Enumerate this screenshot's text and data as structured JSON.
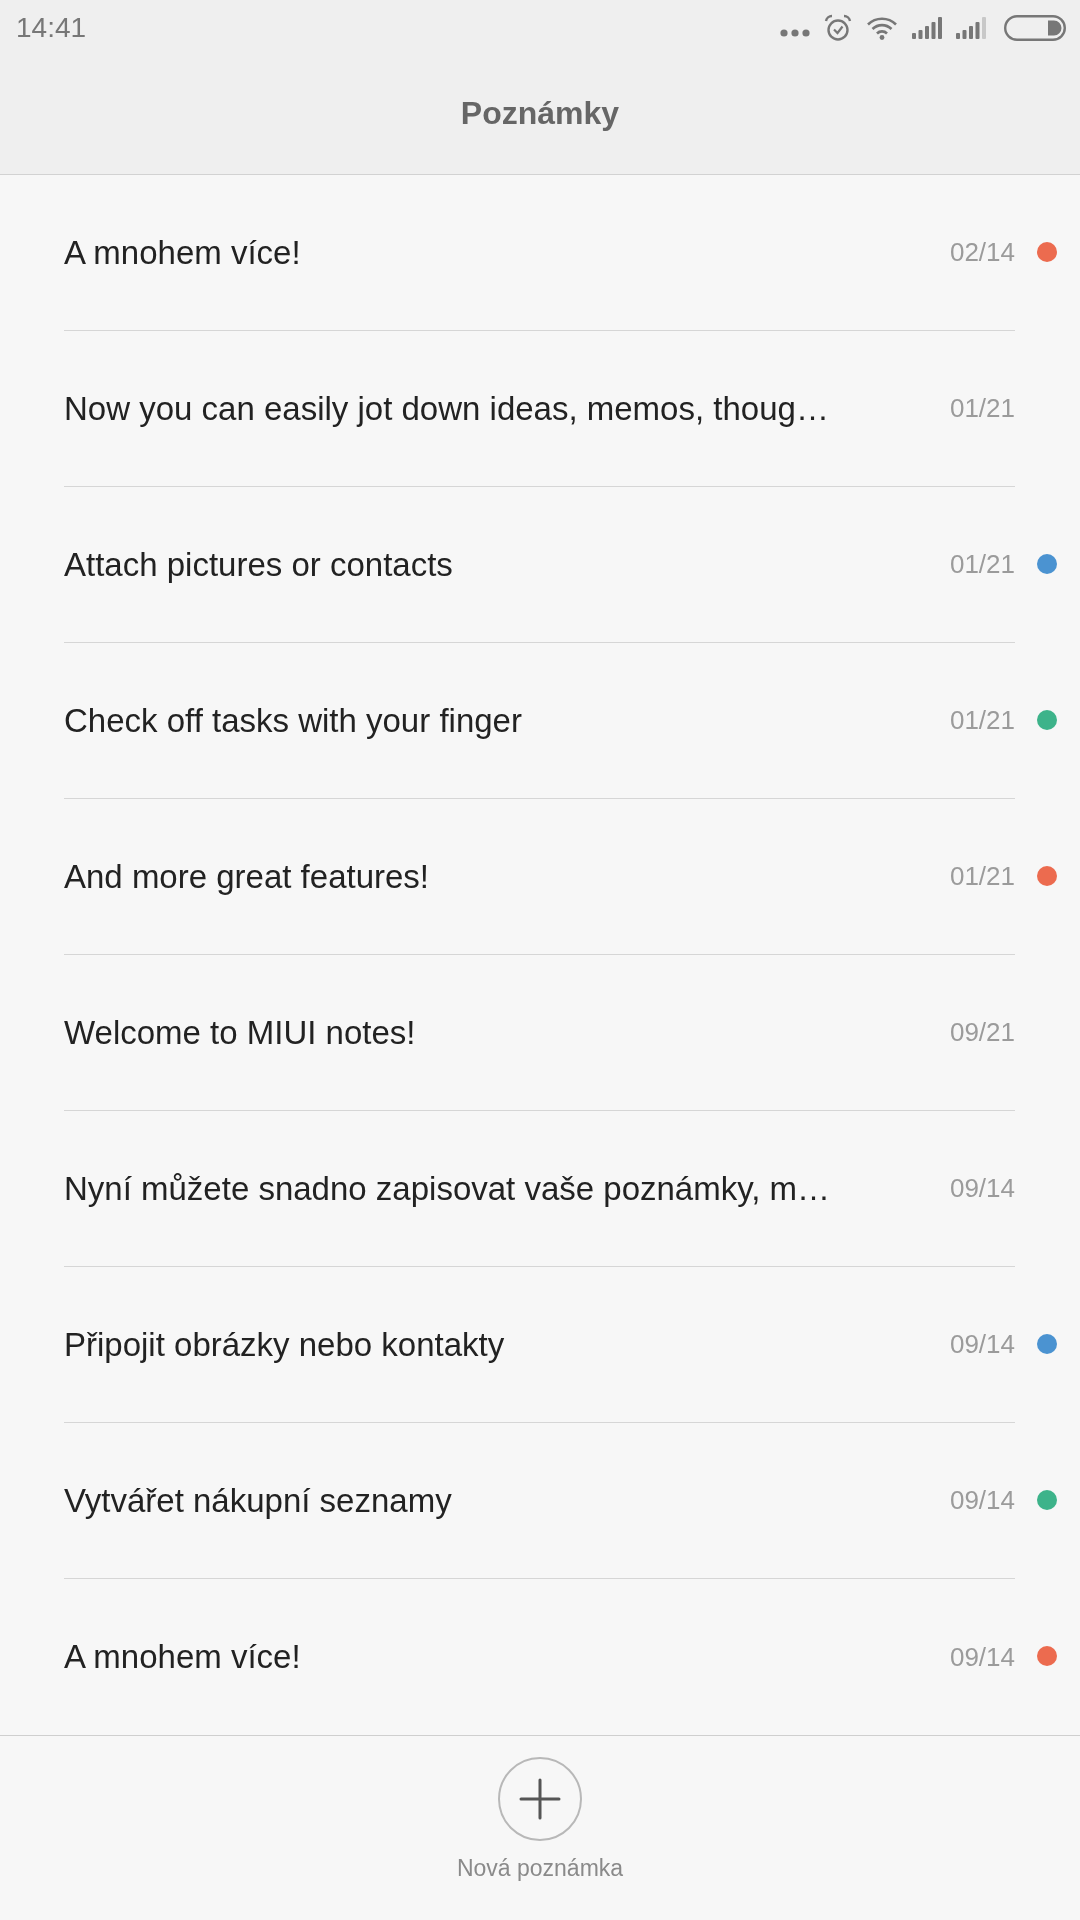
{
  "status_bar": {
    "time": "14:41"
  },
  "header": {
    "title": "Poznámky"
  },
  "notes": [
    {
      "title": "A mnohem více!",
      "date": "02/14",
      "color": "#ec6b4f"
    },
    {
      "title": "Now you can easily jot down ideas, memos, thoug…",
      "date": "01/21"
    },
    {
      "title": "Attach pictures or contacts",
      "date": "01/21",
      "color": "#4b93d1"
    },
    {
      "title": "Check off tasks with your finger",
      "date": "01/21",
      "color": "#3db38a"
    },
    {
      "title": "And more great features!",
      "date": "01/21",
      "color": "#ec6b4f"
    },
    {
      "title": "Welcome to MIUI notes!",
      "date": "09/21"
    },
    {
      "title": "Nyní můžete snadno zapisovat vaše poznámky, m…",
      "date": "09/14"
    },
    {
      "title": "Připojit obrázky nebo kontakty",
      "date": "09/14",
      "color": "#4b93d1"
    },
    {
      "title": "Vytvářet nákupní seznamy",
      "date": "09/14",
      "color": "#3db38a"
    },
    {
      "title": "A mnohem více!",
      "date": "09/14",
      "color": "#ec6b4f"
    }
  ],
  "new_note_button": {
    "label": "Nová poznámka"
  }
}
